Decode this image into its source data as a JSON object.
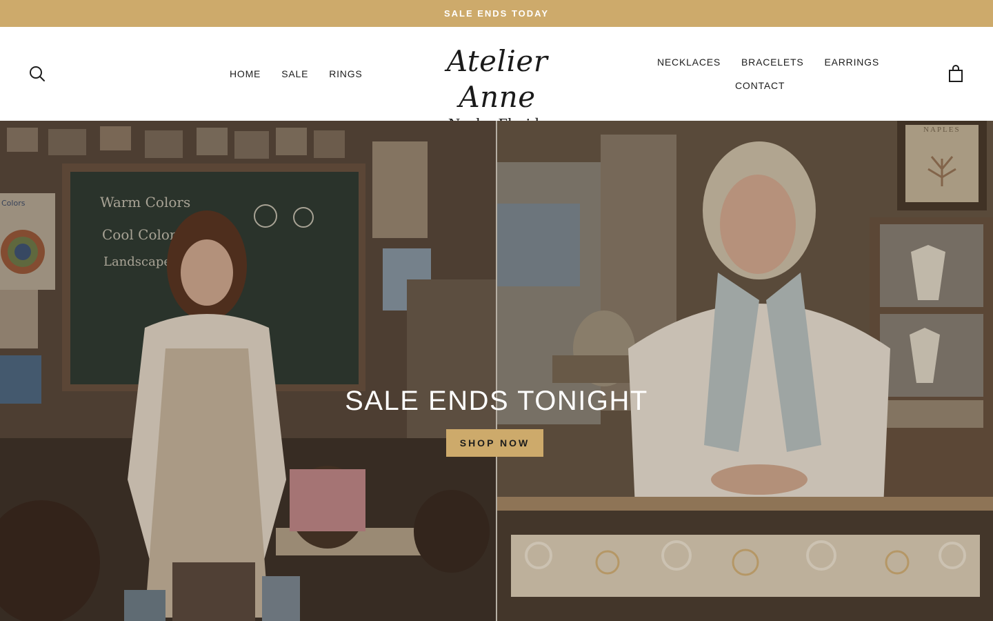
{
  "announcement": {
    "text": "SALE ENDS TODAY"
  },
  "header": {
    "nav_left": [
      "HOME",
      "SALE",
      "RINGS"
    ],
    "logo": {
      "main": "Atelier Anne",
      "sub": "Naples Florida"
    },
    "nav_right": [
      "NECKLACES",
      "BRACELETS",
      "EARRINGS",
      "CONTACT"
    ],
    "icons": {
      "search": "search-icon",
      "cart": "shopping-bag-icon"
    }
  },
  "hero": {
    "title": "SALE ENDS TONIGHT",
    "cta_label": "SHOP NOW",
    "left_image": "art-classroom-teacher-photo",
    "right_image": "jewelry-store-owner-photo",
    "left_chalkboard": [
      "Warm Colors",
      "Cool Colors",
      "Landscape"
    ],
    "left_poster": "Colors",
    "right_frame": "NAPLES"
  },
  "colors": {
    "accent_gold": "#cdaa6b",
    "text_dark": "#1c1c1c",
    "header_bg": "#ffffff"
  }
}
